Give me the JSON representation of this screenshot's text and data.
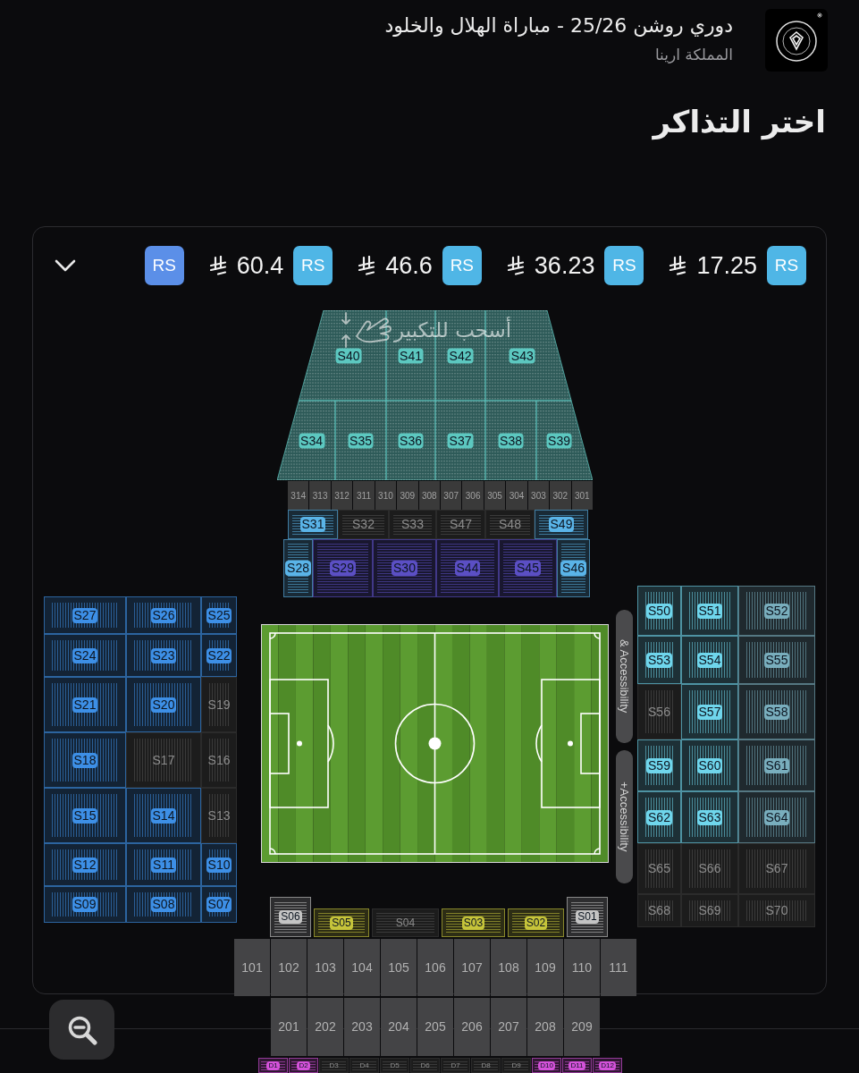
{
  "header": {
    "title": "دوري روشن 25/26 - مباراة الهلال والخلود",
    "venue": "المملكة ارينا"
  },
  "heading": "اختر التذاكر",
  "price_legend": {
    "expanded": false,
    "items": [
      {
        "badge": "RS",
        "color": "#5b8fe8"
      },
      {
        "badge": "RS",
        "price": "60.4",
        "color": "#4fb6e6"
      },
      {
        "badge": "RS",
        "price": "46.6",
        "color": "#4fb6e6"
      },
      {
        "badge": "RS",
        "price": "36.23",
        "color": "#4fb6e6"
      },
      {
        "badge": "RS",
        "price": "17.25",
        "color": "#4fb6e6"
      }
    ]
  },
  "map": {
    "hint": "أسحب للتكبير",
    "upper_tier": [
      {
        "label": "S40",
        "available": true,
        "color": "#5cc8c0"
      },
      {
        "label": "S41",
        "available": true,
        "color": "#5cc8c0"
      },
      {
        "label": "S42",
        "available": true,
        "color": "#5cc8c0"
      },
      {
        "label": "S43",
        "available": true,
        "color": "#5cc8c0"
      }
    ],
    "middle_tier": [
      {
        "label": "S34",
        "available": true,
        "color": "#5cc8c0"
      },
      {
        "label": "S35",
        "available": true,
        "color": "#5cc8c0"
      },
      {
        "label": "S36",
        "available": true,
        "color": "#5cc8c0"
      },
      {
        "label": "S37",
        "available": true,
        "color": "#5cc8c0"
      },
      {
        "label": "S38",
        "available": true,
        "color": "#5cc8c0"
      },
      {
        "label": "S39",
        "available": true,
        "color": "#5cc8c0"
      }
    ],
    "boxes_300": [
      "314",
      "313",
      "312",
      "311",
      "310",
      "309",
      "308",
      "307",
      "306",
      "305",
      "304",
      "303",
      "302",
      "301"
    ],
    "club_row": [
      {
        "label": "S31",
        "available": true,
        "color": "#5ab4e8"
      },
      {
        "label": "S32",
        "available": false
      },
      {
        "label": "S33",
        "available": false
      },
      {
        "label": "S47",
        "available": false
      },
      {
        "label": "S48",
        "available": false
      },
      {
        "label": "S49",
        "available": true,
        "color": "#5ab4e8"
      }
    ],
    "lower_row": [
      {
        "label": "S28",
        "available": true,
        "color": "#5ab4e8"
      },
      {
        "label": "S29",
        "available": true,
        "color": "#5b4fc4"
      },
      {
        "label": "S30",
        "available": true,
        "color": "#5b4fc4"
      },
      {
        "label": "S44",
        "available": true,
        "color": "#5b4fc4"
      },
      {
        "label": "S45",
        "available": true,
        "color": "#5b4fc4"
      },
      {
        "label": "S46",
        "available": true,
        "color": "#5ab4e8"
      }
    ],
    "west_stand": [
      [
        {
          "label": "S27",
          "available": true,
          "color": "#3d8fe6"
        },
        {
          "label": "S26",
          "available": true,
          "color": "#3d8fe6"
        },
        {
          "label": "S25",
          "available": true,
          "color": "#3d8fe6"
        }
      ],
      [
        {
          "label": "S24",
          "available": true,
          "color": "#3d8fe6"
        },
        {
          "label": "S23",
          "available": true,
          "color": "#3d8fe6"
        },
        {
          "label": "S22",
          "available": true,
          "color": "#3d8fe6"
        }
      ],
      [
        {
          "label": "S21",
          "available": true,
          "color": "#3d8fe6"
        },
        {
          "label": "S20",
          "available": true,
          "color": "#3d8fe6"
        },
        {
          "label": "S19",
          "available": false
        }
      ],
      [
        {
          "label": "S18",
          "available": true,
          "color": "#3d8fe6"
        },
        {
          "label": "S17",
          "available": false
        },
        {
          "label": "S16",
          "available": false
        }
      ],
      [
        {
          "label": "S15",
          "available": true,
          "color": "#3d8fe6"
        },
        {
          "label": "S14",
          "available": true,
          "color": "#3d8fe6"
        },
        {
          "label": "S13",
          "available": false
        }
      ],
      [
        {
          "label": "S12",
          "available": true,
          "color": "#3d8fe6"
        },
        {
          "label": "S11",
          "available": true,
          "color": "#3d8fe6"
        },
        {
          "label": "S10",
          "available": true,
          "color": "#3d8fe6"
        }
      ],
      [
        {
          "label": "S09",
          "available": true,
          "color": "#3d8fe6"
        },
        {
          "label": "S08",
          "available": true,
          "color": "#3d8fe6"
        },
        {
          "label": "S07",
          "available": true,
          "color": "#3d8fe6"
        }
      ]
    ],
    "accessibility_labels": [
      "& Accessibility",
      "+Accessibility"
    ],
    "east_stand": [
      [
        {
          "label": "S50",
          "available": true,
          "color": "#6fd6ec"
        },
        {
          "label": "S51",
          "available": true,
          "color": "#6fd6ec"
        },
        {
          "label": "S52",
          "available": true,
          "color": "#79aebd"
        }
      ],
      [
        {
          "label": "S53",
          "available": true,
          "color": "#6fd6ec"
        },
        {
          "label": "S54",
          "available": true,
          "color": "#6fd6ec"
        },
        {
          "label": "S55",
          "available": true,
          "color": "#79aebd"
        }
      ],
      [
        {
          "label": "S56",
          "available": false
        },
        {
          "label": "S57",
          "available": true,
          "color": "#6fd6ec"
        },
        {
          "label": "S58",
          "available": true,
          "color": "#79aebd"
        }
      ],
      [
        {
          "label": "S59",
          "available": true,
          "color": "#6fd6ec"
        },
        {
          "label": "S60",
          "available": true,
          "color": "#6fd6ec"
        },
        {
          "label": "S61",
          "available": true,
          "color": "#79aebd"
        }
      ],
      [
        {
          "label": "S62",
          "available": true,
          "color": "#6fd6ec"
        },
        {
          "label": "S63",
          "available": true,
          "color": "#6fd6ec"
        },
        {
          "label": "S64",
          "available": true,
          "color": "#79aebd"
        }
      ],
      [
        {
          "label": "S65",
          "available": false
        },
        {
          "label": "S66",
          "available": false
        },
        {
          "label": "S67",
          "available": false
        }
      ],
      [
        {
          "label": "S68",
          "available": false
        },
        {
          "label": "S69",
          "available": false
        },
        {
          "label": "S70",
          "available": false
        }
      ]
    ],
    "south_row": [
      {
        "label": "S06",
        "available": true,
        "color": "#c4c4c4"
      },
      {
        "label": "S05",
        "available": true,
        "color": "#c6c43a"
      },
      {
        "label": "S04",
        "available": false
      },
      {
        "label": "S03",
        "available": true,
        "color": "#c6c43a"
      },
      {
        "label": "S02",
        "available": true,
        "color": "#c6c43a"
      },
      {
        "label": "S01",
        "available": true,
        "color": "#c4c4c4"
      }
    ],
    "boxes_100": [
      "101",
      "102",
      "103",
      "104",
      "105",
      "106",
      "107",
      "108",
      "109",
      "110",
      "111"
    ],
    "boxes_200": [
      "201",
      "202",
      "203",
      "204",
      "205",
      "206",
      "207",
      "208",
      "209"
    ],
    "d_row": [
      {
        "label": "D1",
        "available": true,
        "color": "#d452da"
      },
      {
        "label": "D2",
        "available": true,
        "color": "#d452da"
      },
      {
        "label": "D3",
        "available": false
      },
      {
        "label": "D4",
        "available": false
      },
      {
        "label": "D5",
        "available": false
      },
      {
        "label": "D6",
        "available": false
      },
      {
        "label": "D7",
        "available": false
      },
      {
        "label": "D8",
        "available": false
      },
      {
        "label": "D9",
        "available": false
      },
      {
        "label": "D10",
        "available": true,
        "color": "#d452da"
      },
      {
        "label": "D11",
        "available": true,
        "color": "#d452da"
      },
      {
        "label": "D12",
        "available": true,
        "color": "#d452da"
      }
    ]
  }
}
